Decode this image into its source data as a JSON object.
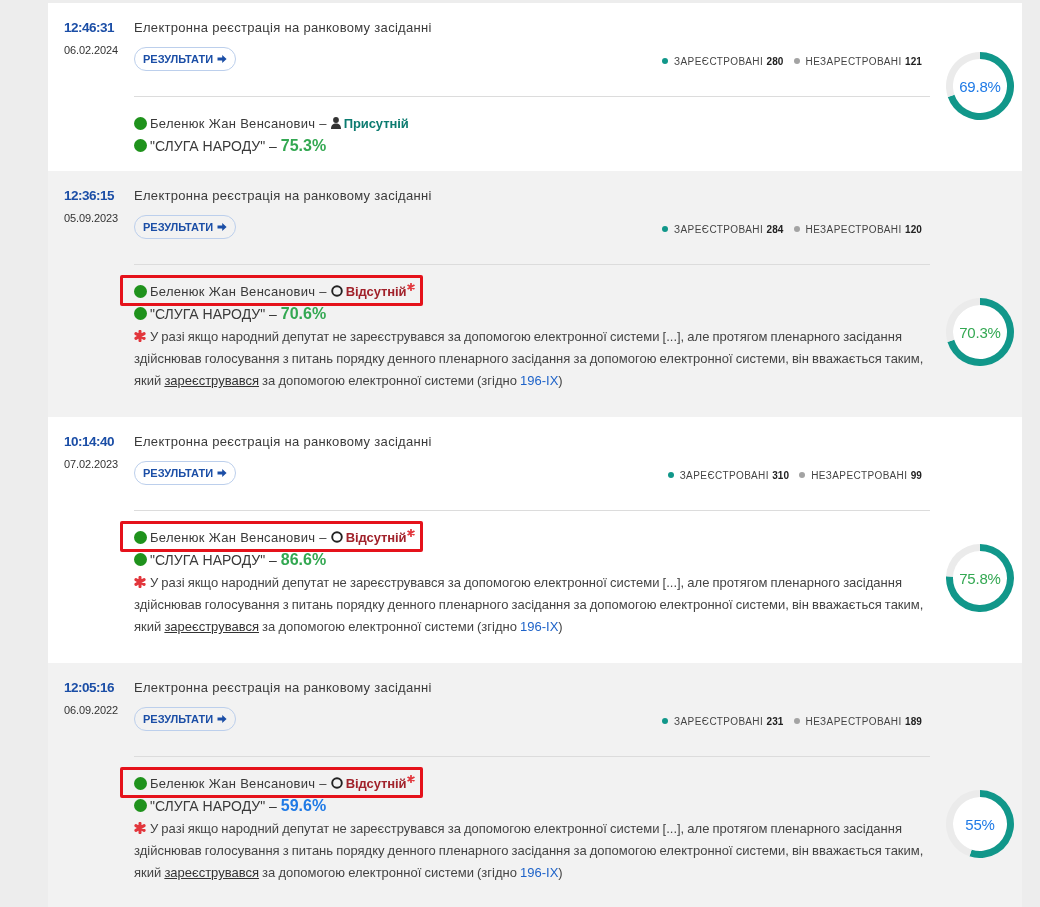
{
  "records": [
    {
      "time": "12:46:31",
      "date": "06.02.2024",
      "title": "Електронна реєстрація на ранковому засіданні",
      "button": "РЕЗУЛЬТАТИ",
      "legend": [
        {
          "label": "ЗАРЕЄСТРОВАНІ **280**",
          "color": "#11978a"
        },
        {
          "label": "НЕЗАРЕСТРОВАНІ **121**",
          "color": "#a3a3a3"
        }
      ],
      "chart_data": {
        "type": "donut",
        "values": [
          69.8,
          30.2
        ]
      },
      "percent": {
        "label": "69.8%",
        "color": "#1f7ae6"
      },
      "deputy": {
        "name": "Беленюк Жан Венсанович –",
        "highlighted": false,
        "status": {
          "kind": "present",
          "label": "Присутній",
          "starred": false
        }
      },
      "party": {
        "name": "\"СЛУГА НАРОДУ\" –",
        "share": "75.3%",
        "color": "#33a852"
      }
    },
    {
      "time": "12:36:15",
      "date": "05.09.2023",
      "title": "Електронна реєстрація на ранковому засіданні",
      "button": "РЕЗУЛЬТАТИ",
      "legend": [
        {
          "label": "ЗАРЕЄСТРОВАНІ **284**",
          "color": "#11978a"
        },
        {
          "label": "НЕЗАРЕСТРОВАНІ **120**",
          "color": "#a3a3a3"
        }
      ],
      "chart_data": {
        "type": "donut",
        "values": [
          70.3,
          29.7
        ]
      },
      "percent": {
        "label": "70.3%",
        "color": "#33a852"
      },
      "deputy": {
        "name": "Беленюк Жан Венсанович –",
        "highlighted": true,
        "status": {
          "kind": "absent",
          "label": "Відсутній",
          "starred": true
        }
      },
      "party": {
        "name": "\"СЛУГА НАРОДУ\" –",
        "share": "70.6%",
        "color": "#33a852"
      },
      "note": {
        "text_before": "У разі якщо народний депутат не зареєструвався за допомогою електронної системи [...], але протягом пленарного засідання здійснював голосування з питань порядку денного пленарного засідання за допомогою електронної системи, він вважається таким, який",
        "term": "зареєструвався",
        "text_middle": "за допомогою електронної системи (згідно",
        "link": "196-IX",
        "text_after": ")"
      }
    },
    {
      "time": "10:14:40",
      "date": "07.02.2023",
      "title": "Електронна реєстрація на ранковому засіданні",
      "button": "РЕЗУЛЬТАТИ",
      "legend": [
        {
          "label": "ЗАРЕЄСТРОВАНІ **310**",
          "color": "#11978a"
        },
        {
          "label": "НЕЗАРЕСТРОВАНІ **99**",
          "color": "#a3a3a3"
        }
      ],
      "chart_data": {
        "type": "donut",
        "values": [
          75.8,
          24.2
        ]
      },
      "percent": {
        "label": "75.8%",
        "color": "#33a852"
      },
      "deputy": {
        "name": "Беленюк Жан Венсанович –",
        "highlighted": true,
        "status": {
          "kind": "absent",
          "label": "Відсутній",
          "starred": true
        }
      },
      "party": {
        "name": "\"СЛУГА НАРОДУ\" –",
        "share": "86.6%",
        "color": "#33a852"
      },
      "note": {
        "text_before": "У разі якщо народний депутат не зареєструвався за допомогою електронної системи [...], але протягом пленарного засідання здійснював голосування з питань порядку денного пленарного засідання за допомогою електронної системи, він вважається таким, який",
        "term": "зареєструвався",
        "text_middle": "за допомогою електронної системи (згідно",
        "link": "196-IX",
        "text_after": ")"
      }
    },
    {
      "time": "12:05:16",
      "date": "06.09.2022",
      "title": "Електронна реєстрація на ранковому засіданні",
      "button": "РЕЗУЛЬТАТИ",
      "legend": [
        {
          "label": "ЗАРЕЄСТРОВАНІ **231**",
          "color": "#11978a"
        },
        {
          "label": "НЕЗАРЕСТРОВАНІ **189**",
          "color": "#a3a3a3"
        }
      ],
      "chart_data": {
        "type": "donut",
        "values": [
          55,
          45
        ]
      },
      "percent": {
        "label": "55%",
        "color": "#1f7ae6"
      },
      "deputy": {
        "name": "Беленюк Жан Венсанович –",
        "highlighted": true,
        "status": {
          "kind": "absent",
          "label": "Відсутній",
          "starred": true
        }
      },
      "party": {
        "name": "\"СЛУГА НАРОДУ\" –",
        "share": "59.6%",
        "color": "#1f7ae6"
      },
      "note": {
        "text_before": "У разі якщо народний депутат не зареєструвався за допомогою електронної системи [...], але протягом пленарного засідання здійснював голосування з питань порядку денного пленарного засідання за допомогою електронної системи, він вважається таким, який",
        "term": "зареєструвався",
        "text_middle": "за допомогою електронної системи (згідно",
        "link": "196-IX",
        "text_after": ")"
      }
    }
  ]
}
